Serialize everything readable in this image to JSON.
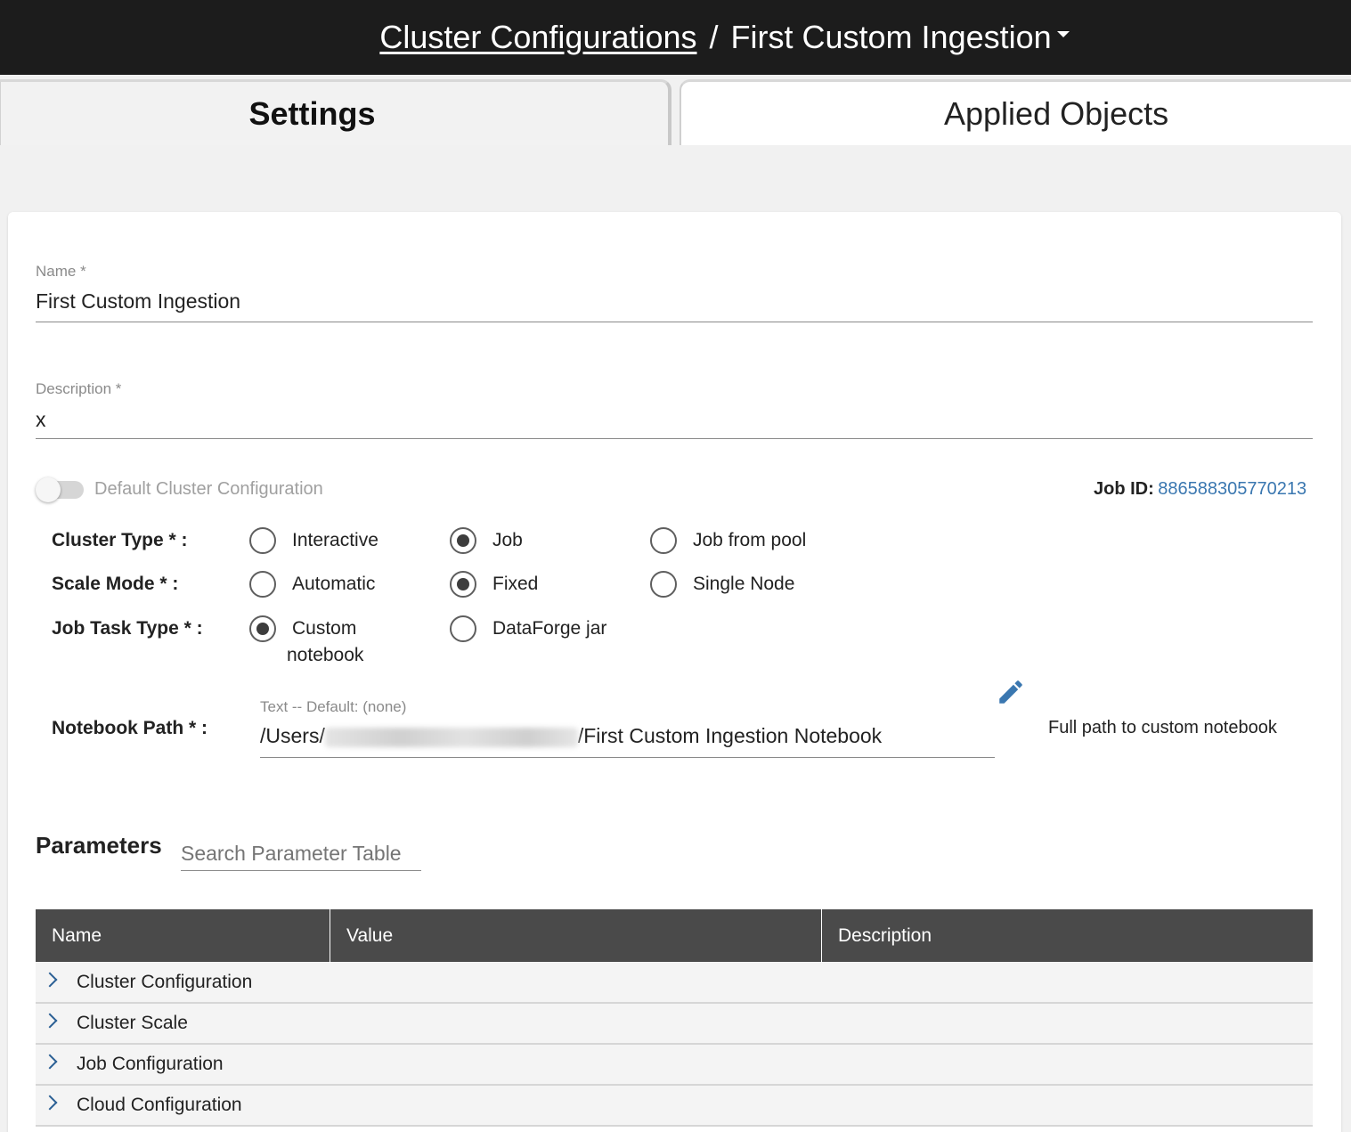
{
  "header": {
    "breadcrumb_link": "Cluster Configurations",
    "separator": "/",
    "current": "First Custom Ingestion"
  },
  "tabs": [
    {
      "label": "Settings",
      "active": true
    },
    {
      "label": "Applied Objects",
      "active": false
    }
  ],
  "form": {
    "name": {
      "label": "Name *",
      "value": "First Custom Ingestion"
    },
    "description": {
      "label": "Description *",
      "value": "x"
    },
    "default_toggle": {
      "label": "Default Cluster Configuration",
      "on": false
    },
    "job_id": {
      "label": "Job ID:",
      "value": "886588305770213"
    },
    "cluster_type": {
      "label": "Cluster Type * :",
      "options": [
        "Interactive",
        "Job",
        "Job from pool"
      ],
      "selected": "Job"
    },
    "scale_mode": {
      "label": "Scale Mode * :",
      "options": [
        "Automatic",
        "Fixed",
        "Single Node"
      ],
      "selected": "Fixed"
    },
    "job_task_type": {
      "label": "Job Task Type * :",
      "options": [
        "Custom",
        "DataForge jar"
      ],
      "option_0_line2": "notebook",
      "selected": "Custom notebook"
    },
    "notebook_path": {
      "label": "Notebook Path * :",
      "hint": "Text -- Default: (none)",
      "value_prefix": "/Users/",
      "value_suffix": "/First Custom Ingestion Notebook",
      "help": "Full path to custom notebook"
    }
  },
  "parameters": {
    "title": "Parameters",
    "search_placeholder": "Search Parameter Table",
    "columns": [
      "Name",
      "Value",
      "Description"
    ],
    "rows": [
      "Cluster Configuration",
      "Cluster Scale",
      "Job Configuration",
      "Cloud Configuration"
    ]
  },
  "colors": {
    "header_bg": "#1c1c1c",
    "link_blue": "#3a77b0",
    "table_header_bg": "#4a4a4a"
  }
}
